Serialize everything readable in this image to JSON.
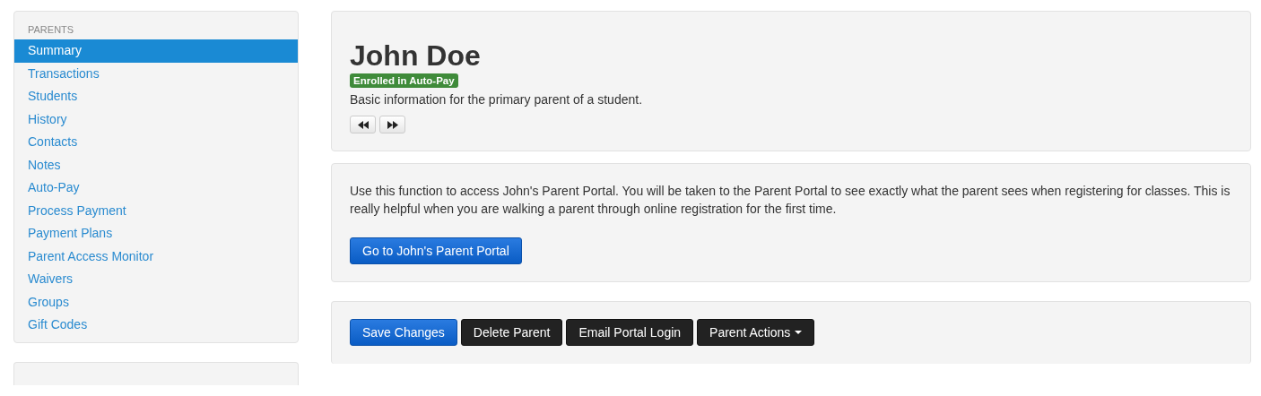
{
  "sidebar": {
    "heading": "PARENTS",
    "items": [
      {
        "label": "Summary",
        "selected": true
      },
      {
        "label": "Transactions",
        "selected": false
      },
      {
        "label": "Students",
        "selected": false
      },
      {
        "label": "History",
        "selected": false
      },
      {
        "label": "Contacts",
        "selected": false
      },
      {
        "label": "Notes",
        "selected": false
      },
      {
        "label": "Auto-Pay",
        "selected": false
      },
      {
        "label": "Process Payment",
        "selected": false
      },
      {
        "label": "Payment Plans",
        "selected": false
      },
      {
        "label": "Parent Access Monitor",
        "selected": false
      },
      {
        "label": "Waivers",
        "selected": false
      },
      {
        "label": "Groups",
        "selected": false
      },
      {
        "label": "Gift Codes",
        "selected": false
      }
    ]
  },
  "header": {
    "title": "John Doe",
    "badge": "Enrolled in Auto-Pay",
    "description": "Basic information for the primary parent of a student."
  },
  "portal": {
    "text": "Use this function to access John's Parent Portal. You will be taken to the Parent Portal to see exactly what the parent sees when registering for classes. This is really helpful when you are walking a parent through online registration for the first time.",
    "button": "Go to John's Parent Portal"
  },
  "actions": [
    {
      "label": "Save Changes",
      "kind": "primary"
    },
    {
      "label": "Delete Parent",
      "kind": "dark"
    },
    {
      "label": "Email Portal Login",
      "kind": "dark"
    },
    {
      "label": "Parent Actions",
      "kind": "dropdown"
    }
  ]
}
